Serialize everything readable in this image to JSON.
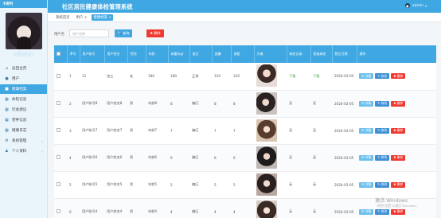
{
  "sidebar": {
    "brand": "卡奇时",
    "username": "admin",
    "items": [
      {
        "label": "返回主页",
        "icon": "home-icon",
        "glyph": "⌂",
        "active": false
      },
      {
        "label": "用户",
        "icon": "user-icon",
        "glyph": "●",
        "active": false
      },
      {
        "label": "健康档案",
        "icon": "document-icon",
        "glyph": "■",
        "active": true
      },
      {
        "label": "体检信息",
        "icon": "grid-icon",
        "glyph": "▦",
        "active": false
      },
      {
        "label": "饮食建议",
        "icon": "grid-icon",
        "glyph": "▦",
        "active": false
      },
      {
        "label": "营养信息",
        "icon": "grid-icon",
        "glyph": "▦",
        "active": false
      },
      {
        "label": "健康日志",
        "icon": "grid-icon",
        "glyph": "▦",
        "active": false
      },
      {
        "label": "系统管理",
        "icon": "settings-icon",
        "glyph": "⚙",
        "active": false,
        "arrow": "‹"
      },
      {
        "label": "个人资料",
        "icon": "person-icon",
        "glyph": "♟",
        "active": false,
        "arrow": "‹"
      }
    ]
  },
  "header": {
    "title": "社区居民健康体检管理系统",
    "user": "admin",
    "caret": "▾"
  },
  "tabs": [
    {
      "label": "系统首页",
      "active": false
    },
    {
      "label": "用户 ×",
      "active": false
    },
    {
      "label": "健康档案 ×",
      "active": true
    }
  ],
  "search": {
    "label": "用户名",
    "placeholder": "用户名称",
    "search_label": "🔍 查询",
    "delete_label": "✖ 删除"
  },
  "table": {
    "columns": [
      "",
      "序号",
      "用户账号",
      "用户姓名",
      "性别",
      "年龄",
      "体重(kg)",
      "血压",
      "血糖",
      "血脂",
      "头像",
      "病史记录",
      "家族病史",
      "登记日期",
      "操作"
    ],
    "rows": [
      {
        "idx": "1",
        "account": "11",
        "name": "张三",
        "gender": "女",
        "age": "180",
        "weight": "180",
        "bp": "正常",
        "sugar": "120",
        "fat": "120",
        "history": "下载",
        "family": "下载",
        "date": "2024-02-05",
        "photo": "p1"
      },
      {
        "idx": "2",
        "account": "用户账号8",
        "name": "用户姓名8",
        "gender": "男",
        "age": "年龄8",
        "weight": "8",
        "bp": "偏压",
        "sugar": "8",
        "fat": "8",
        "history": "无",
        "family": "无",
        "date": "2024-02-05",
        "photo": "p2"
      },
      {
        "idx": "3",
        "account": "用户账号7",
        "name": "用户姓名7",
        "gender": "男",
        "age": "年龄7",
        "weight": "7",
        "bp": "偏压",
        "sugar": "7",
        "fat": "7",
        "history": "无",
        "family": "无",
        "date": "2024-02-05",
        "photo": "p3"
      },
      {
        "idx": "4",
        "account": "用户账号6",
        "name": "用户姓名6",
        "gender": "男",
        "age": "年龄6",
        "weight": "6",
        "bp": "偏压",
        "sugar": "6",
        "fat": "6",
        "history": "无",
        "family": "无",
        "date": "2024-02-05",
        "photo": "p4"
      },
      {
        "idx": "5",
        "account": "用户账号5",
        "name": "用户姓名5",
        "gender": "男",
        "age": "年龄5",
        "weight": "5",
        "bp": "偏压",
        "sugar": "5",
        "fat": "5",
        "history": "无",
        "family": "无",
        "date": "2024-02-05",
        "photo": "p5"
      },
      {
        "idx": "6",
        "account": "用户账号4",
        "name": "用户姓名4",
        "gender": "男",
        "age": "年龄4",
        "weight": "4",
        "bp": "偏压",
        "sugar": "4",
        "fat": "4",
        "history": "无",
        "family": "无",
        "date": "2024-02-05",
        "photo": "p6"
      }
    ],
    "actions": {
      "detail": "☰ 详情",
      "edit": "✎ 修改",
      "delete": "✖ 删除"
    }
  },
  "watermark": {
    "line1": "激活 Windows",
    "line2": "转到\"设置\"以激活 Windows。"
  },
  "colors": {
    "accent": "#3fa7e1",
    "danger": "#ef3a32",
    "edit": "#3f8fd5"
  }
}
